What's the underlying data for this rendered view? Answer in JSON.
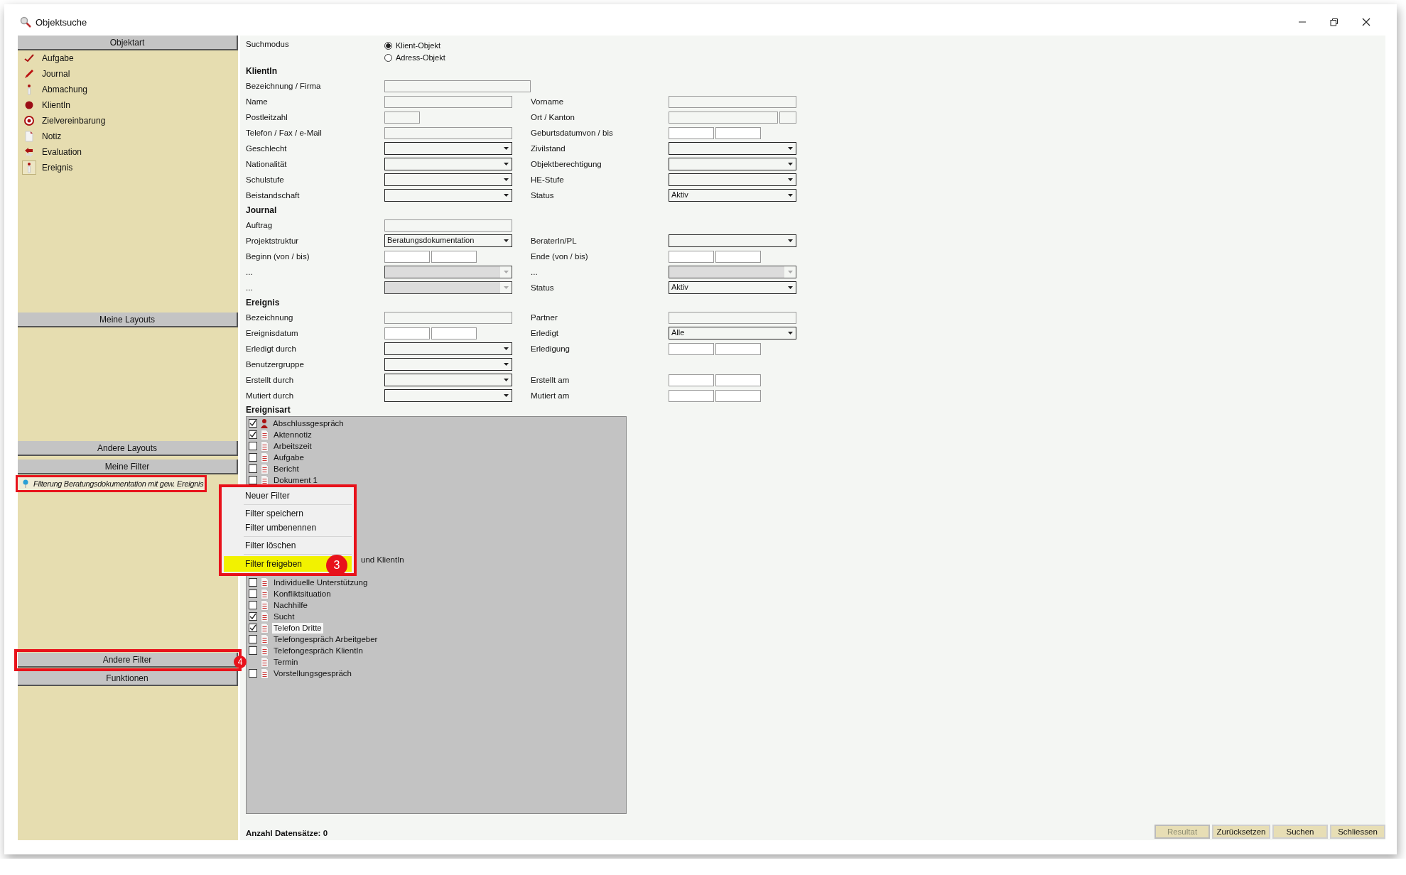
{
  "window": {
    "title": "Objektsuche"
  },
  "left_panel": [
    {
      "header": "Objektart",
      "items": [
        {
          "label": "Aufgabe",
          "selected": false
        },
        {
          "label": "Journal",
          "selected": false
        },
        {
          "label": "Abmachung",
          "selected": false
        },
        {
          "label": "KlientIn",
          "selected": false
        },
        {
          "label": "Zielvereinbarung",
          "selected": false
        },
        {
          "label": "Notiz",
          "selected": false
        },
        {
          "label": "Evaluation",
          "selected": false
        },
        {
          "label": "Ereignis",
          "selected": true
        }
      ]
    },
    {
      "header": "Meine Layouts"
    },
    {
      "header": "Andere Layouts"
    },
    {
      "header": "Meine Filter",
      "items": [
        {
          "label": "Filterung Beratungsdokumentation mit gew. Ereignis",
          "highlighted": true
        }
      ]
    },
    {
      "header": "Andere Filter",
      "highlighted": true,
      "badge": "4"
    },
    {
      "header": "Funktionen"
    }
  ],
  "form": {
    "suchmodus": {
      "label": "Suchmodus",
      "options": [
        {
          "label": "Klient-Objekt",
          "selected": true
        },
        {
          "label": "Adress-Objekt",
          "selected": false
        }
      ]
    },
    "sections": [
      {
        "title": "KlientIn",
        "rows": [
          {
            "left": {
              "label": "Bezeichnung / Firma",
              "kind": "wide"
            }
          },
          {
            "left": {
              "label": "Name",
              "kind": "text"
            },
            "right": {
              "label": "Vorname",
              "kind": "text"
            }
          },
          {
            "left": {
              "label": "Postleitzahl",
              "kind": "short"
            },
            "right": {
              "label": "Ort / Kanton",
              "kind": "ort"
            }
          },
          {
            "left": {
              "label": "Telefon / Fax / e-Mail",
              "kind": "text"
            },
            "right": {
              "label": "Geburtsdatumvon / bis",
              "kind": "pair"
            }
          },
          {
            "left": {
              "label": "Geschlecht",
              "kind": "combo",
              "disabled": false
            },
            "right": {
              "label": "Zivilstand",
              "kind": "combo",
              "disabled": false
            }
          },
          {
            "left": {
              "label": "Nationalität",
              "kind": "combo",
              "disabled": false
            },
            "right": {
              "label": "Objektberechtigung",
              "kind": "combo",
              "disabled": false
            }
          },
          {
            "left": {
              "label": "Schulstufe",
              "kind": "combo",
              "disabled": false
            },
            "right": {
              "label": "HE-Stufe",
              "kind": "combo",
              "disabled": false
            }
          },
          {
            "left": {
              "label": "Beistandschaft",
              "kind": "combo",
              "disabled": false
            },
            "right": {
              "label": "Status",
              "kind": "combo",
              "disabled": false,
              "value": "Aktiv"
            }
          }
        ]
      },
      {
        "title": "Journal",
        "rows": [
          {
            "left": {
              "label": "Auftrag",
              "kind": "text"
            }
          },
          {
            "left": {
              "label": "Projektstruktur",
              "kind": "combo",
              "disabled": false,
              "value": "Beratungsdokumentation"
            },
            "right": {
              "label": "BeraterIn/PL",
              "kind": "combo",
              "disabled": false
            }
          },
          {
            "left": {
              "label": "Beginn (von / bis)",
              "kind": "pair"
            },
            "right": {
              "label": "Ende (von / bis)",
              "kind": "pair"
            }
          },
          {
            "left": {
              "label": "...",
              "kind": "combo",
              "disabled": true
            },
            "right": {
              "label": "...",
              "kind": "combo",
              "disabled": true
            }
          },
          {
            "left": {
              "label": "...",
              "kind": "combo",
              "disabled": true
            },
            "right": {
              "label": "Status",
              "kind": "combo",
              "disabled": false,
              "value": "Aktiv"
            }
          }
        ]
      },
      {
        "title": "Ereignis",
        "rows": [
          {
            "left": {
              "label": "Bezeichnung",
              "kind": "text"
            },
            "right": {
              "label": "Partner",
              "kind": "text"
            }
          },
          {
            "left": {
              "label": "Ereignisdatum",
              "kind": "pair"
            },
            "right": {
              "label": "Erledigt",
              "kind": "combo",
              "disabled": false,
              "value": "Alle"
            }
          },
          {
            "left": {
              "label": "Erledigt durch",
              "kind": "combo",
              "disabled": false
            },
            "right": {
              "label": "Erledigung",
              "kind": "pair"
            }
          },
          {
            "left": {
              "label": "Benutzergruppe",
              "kind": "combo",
              "disabled": false
            }
          },
          {
            "left": {
              "label": "Erstellt durch",
              "kind": "combo",
              "disabled": false
            },
            "right": {
              "label": "Erstellt am",
              "kind": "pair"
            }
          },
          {
            "left": {
              "label": "Mutiert durch",
              "kind": "combo",
              "disabled": false
            },
            "right": {
              "label": "Mutiert am",
              "kind": "pair"
            }
          }
        ]
      }
    ],
    "ereignisart": {
      "title": "Ereignisart",
      "items": [
        {
          "kind": "check",
          "label": "Abschlussgespräch",
          "checked": true,
          "selected": false
        },
        {
          "kind": "check",
          "label": "Aktennotiz",
          "checked": true,
          "selected": false
        },
        {
          "kind": "check",
          "label": "Arbeitszeit",
          "checked": false,
          "selected": false
        },
        {
          "kind": "check",
          "label": "Aufgabe",
          "checked": false,
          "selected": false
        },
        {
          "kind": "check",
          "label": "Bericht",
          "checked": false,
          "selected": false
        },
        {
          "kind": "check",
          "label": "Dokument 1",
          "checked": false,
          "selected": false
        },
        {
          "kind": "fragment",
          "label": "und KlientIn"
        },
        {
          "kind": "check",
          "label": "Individuelle Unterstützung",
          "checked": false,
          "selected": false
        },
        {
          "kind": "check",
          "label": "Konfliktsituation",
          "checked": false,
          "selected": false
        },
        {
          "kind": "check",
          "label": "Nachhilfe",
          "checked": false,
          "selected": false
        },
        {
          "kind": "check",
          "label": "Sucht",
          "checked": true,
          "selected": false
        },
        {
          "kind": "check",
          "label": "Telefon Dritte",
          "checked": true,
          "selected": true
        },
        {
          "kind": "check",
          "label": "Telefongespräch Arbeitgeber",
          "checked": false,
          "selected": false
        },
        {
          "kind": "check",
          "label": "Telefongespräch KlientIn",
          "checked": false,
          "selected": false
        },
        {
          "kind": "check",
          "label": "Termin",
          "selected": false
        },
        {
          "kind": "check",
          "label": "Vorstellungsgespräch",
          "checked": false,
          "selected": false
        }
      ]
    }
  },
  "context_menu": {
    "highlighted": true,
    "items": [
      {
        "kind": "item",
        "label": "Neuer Filter",
        "selected": false
      },
      {
        "kind": "separator"
      },
      {
        "kind": "item",
        "label": "Filter speichern",
        "selected": false
      },
      {
        "kind": "item",
        "label": "Filter umbenennen",
        "selected": false
      },
      {
        "kind": "separator"
      },
      {
        "kind": "item",
        "label": "Filter löschen",
        "selected": false
      },
      {
        "kind": "separator"
      },
      {
        "kind": "item",
        "label": "Filter freigeben",
        "selected": true,
        "badge": "3"
      }
    ]
  },
  "status_bar": {
    "text": "Anzahl Datensätze: 0"
  },
  "buttons": [
    {
      "label": "Resultat",
      "disabled": true
    },
    {
      "label": "Zurücksetzen",
      "disabled": false
    },
    {
      "label": "Suchen",
      "disabled": false
    },
    {
      "label": "Schliessen",
      "disabled": false
    }
  ]
}
